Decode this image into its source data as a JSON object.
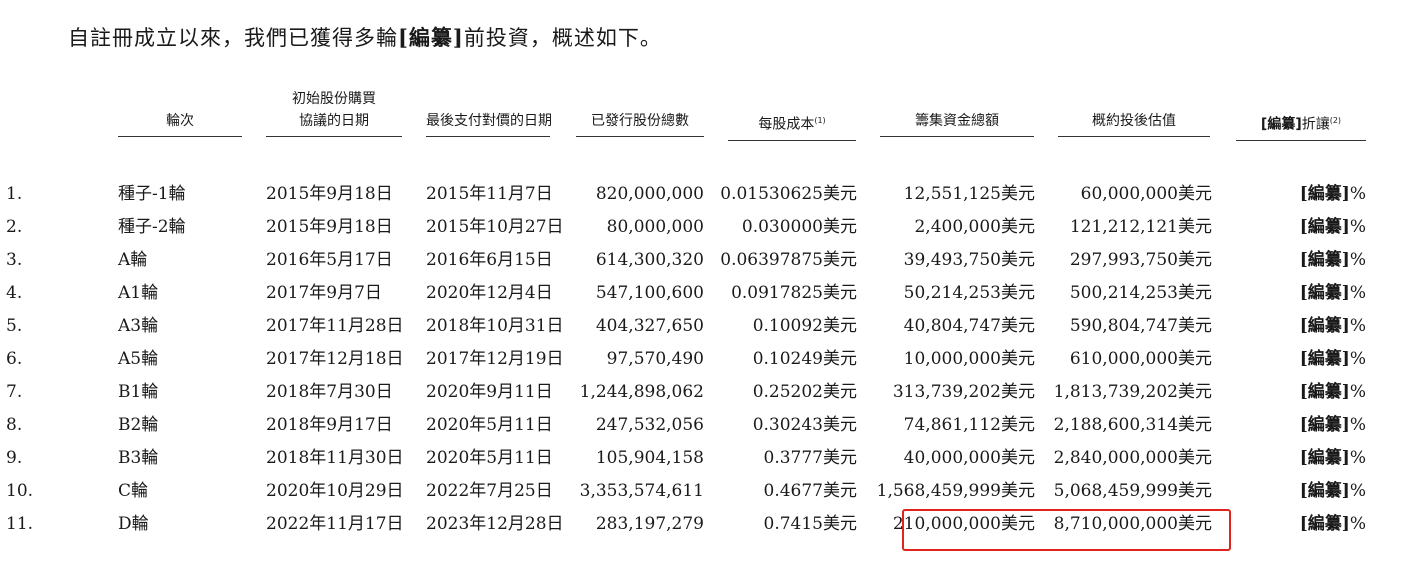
{
  "intro": {
    "prefix": "自註冊成立以來，我們已獲得多輪",
    "redaction": "[編纂]",
    "suffix": "前投資，概述如下。"
  },
  "headers": {
    "round": "輪次",
    "agreement_date_line1": "初始股份購買",
    "agreement_date_line2": "協議的日期",
    "final_payment_date": "最後支付對價的日期",
    "total_shares": "已發行股份總數",
    "cost_per_share": "每股成本",
    "cost_per_share_note": "(1)",
    "total_raised": "籌集資金總額",
    "post_money_valuation": "概約投後估值",
    "discount_redaction": "[編纂]",
    "discount": "折讓",
    "discount_note": "(2)"
  },
  "rows": [
    {
      "no": "1.",
      "round": "種子-1輪",
      "agreement_date": "2015年9月18日",
      "final_payment": "2015年11月7日",
      "shares": "820,000,000",
      "cost": "0.01530625美元",
      "raised": "12,551,125美元",
      "valuation": "60,000,000美元",
      "disc_redact": "[編纂]",
      "disc_unit": "%"
    },
    {
      "no": "2.",
      "round": "種子-2輪",
      "agreement_date": "2015年9月18日",
      "final_payment": "2015年10月27日",
      "shares": "80,000,000",
      "cost": "0.030000美元",
      "raised": "2,400,000美元",
      "valuation": "121,212,121美元",
      "disc_redact": "[編纂]",
      "disc_unit": "%"
    },
    {
      "no": "3.",
      "round": "A輪",
      "agreement_date": "2016年5月17日",
      "final_payment": "2016年6月15日",
      "shares": "614,300,320",
      "cost": "0.06397875美元",
      "raised": "39,493,750美元",
      "valuation": "297,993,750美元",
      "disc_redact": "[編纂]",
      "disc_unit": "%"
    },
    {
      "no": "4.",
      "round": "A1輪",
      "agreement_date": "2017年9月7日",
      "final_payment": "2020年12月4日",
      "shares": "547,100,600",
      "cost": "0.0917825美元",
      "raised": "50,214,253美元",
      "valuation": "500,214,253美元",
      "disc_redact": "[編纂]",
      "disc_unit": "%"
    },
    {
      "no": "5.",
      "round": "A3輪",
      "agreement_date": "2017年11月28日",
      "final_payment": "2018年10月31日",
      "shares": "404,327,650",
      "cost": "0.10092美元",
      "raised": "40,804,747美元",
      "valuation": "590,804,747美元",
      "disc_redact": "[編纂]",
      "disc_unit": "%"
    },
    {
      "no": "6.",
      "round": "A5輪",
      "agreement_date": "2017年12月18日",
      "final_payment": "2017年12月19日",
      "shares": "97,570,490",
      "cost": "0.10249美元",
      "raised": "10,000,000美元",
      "valuation": "610,000,000美元",
      "disc_redact": "[編纂]",
      "disc_unit": "%"
    },
    {
      "no": "7.",
      "round": "B1輪",
      "agreement_date": "2018年7月30日",
      "final_payment": "2020年9月11日",
      "shares": "1,244,898,062",
      "cost": "0.25202美元",
      "raised": "313,739,202美元",
      "valuation": "1,813,739,202美元",
      "disc_redact": "[編纂]",
      "disc_unit": "%"
    },
    {
      "no": "8.",
      "round": "B2輪",
      "agreement_date": "2018年9月17日",
      "final_payment": "2020年5月11日",
      "shares": "247,532,056",
      "cost": "0.30243美元",
      "raised": "74,861,112美元",
      "valuation": "2,188,600,314美元",
      "disc_redact": "[編纂]",
      "disc_unit": "%"
    },
    {
      "no": "9.",
      "round": "B3輪",
      "agreement_date": "2018年11月30日",
      "final_payment": "2020年5月11日",
      "shares": "105,904,158",
      "cost": "0.3777美元",
      "raised": "40,000,000美元",
      "valuation": "2,840,000,000美元",
      "disc_redact": "[編纂]",
      "disc_unit": "%"
    },
    {
      "no": "10.",
      "round": "C輪",
      "agreement_date": "2020年10月29日",
      "final_payment": "2022年7月25日",
      "shares": "3,353,574,611",
      "cost": "0.4677美元",
      "raised": "1,568,459,999美元",
      "valuation": "5,068,459,999美元",
      "disc_redact": "[編纂]",
      "disc_unit": "%"
    },
    {
      "no": "11.",
      "round": "D輪",
      "agreement_date": "2022年11月17日",
      "final_payment": "2023年12月28日",
      "shares": "283,197,279",
      "cost": "0.7415美元",
      "raised": "210,000,000美元",
      "valuation": "8,710,000,000美元",
      "disc_redact": "[編纂]",
      "disc_unit": "%"
    }
  ],
  "highlight_color": "#e0241d"
}
